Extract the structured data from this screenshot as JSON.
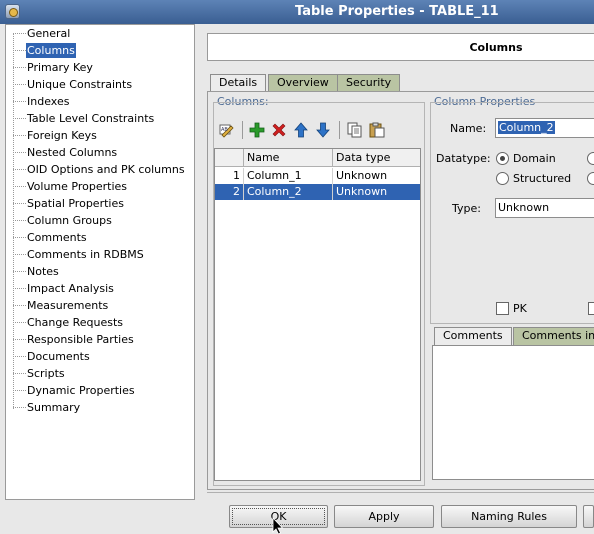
{
  "window": {
    "title": "Table Properties - TABLE_11"
  },
  "nav": {
    "items": [
      {
        "label": "General"
      },
      {
        "label": "Columns",
        "selected": true
      },
      {
        "label": "Primary Key"
      },
      {
        "label": "Unique Constraints"
      },
      {
        "label": "Indexes"
      },
      {
        "label": "Table Level Constraints"
      },
      {
        "label": "Foreign Keys"
      },
      {
        "label": "Nested Columns"
      },
      {
        "label": "OID Options and PK columns"
      },
      {
        "label": "Volume Properties"
      },
      {
        "label": "Spatial Properties"
      },
      {
        "label": "Column Groups"
      },
      {
        "label": "Comments"
      },
      {
        "label": "Comments in RDBMS"
      },
      {
        "label": "Notes"
      },
      {
        "label": "Impact Analysis"
      },
      {
        "label": "Measurements"
      },
      {
        "label": "Change Requests"
      },
      {
        "label": "Responsible Parties"
      },
      {
        "label": "Documents"
      },
      {
        "label": "Scripts"
      },
      {
        "label": "Dynamic Properties"
      },
      {
        "label": "Summary"
      }
    ]
  },
  "header": {
    "title": "Columns"
  },
  "tabs": [
    {
      "label": "Details",
      "active": true
    },
    {
      "label": "Overview"
    },
    {
      "label": "Security"
    }
  ],
  "columns_group": {
    "title": "Columns:",
    "toolbar": [
      {
        "icon": "edit-icon"
      },
      {
        "icon": "add-icon"
      },
      {
        "icon": "delete-icon"
      },
      {
        "icon": "move-up-icon"
      },
      {
        "icon": "move-down-icon"
      },
      {
        "icon": "copy-icon"
      },
      {
        "icon": "paste-icon"
      }
    ],
    "grid": {
      "headers": [
        "Name",
        "Data type"
      ],
      "rows": [
        {
          "num": "1",
          "name": "Column_1",
          "type": "Unknown"
        },
        {
          "num": "2",
          "name": "Column_2",
          "type": "Unknown",
          "selected": true
        }
      ]
    }
  },
  "properties": {
    "title": "Column Properties",
    "name_label": "Name:",
    "name_value": "Column_2",
    "datatype_label": "Datatype:",
    "datatype_options": [
      "Domain",
      "Structured"
    ],
    "datatype_selected": "Domain",
    "type_label": "Type:",
    "type_value": "Unknown",
    "pk_label": "PK",
    "comment_tabs": [
      "Comments",
      "Comments in"
    ]
  },
  "buttons": {
    "ok": "OK",
    "apply": "Apply",
    "naming_rules": "Naming Rules"
  },
  "colors": {
    "selection": "#2f63b2",
    "title_bar": "#4a6fa5",
    "inactive_tab": "#b9c4a3",
    "group_title": "#4d6b94",
    "add_icon": "#2a9a2a",
    "delete_icon": "#d02020",
    "arrow_icon": "#2d72c6"
  }
}
